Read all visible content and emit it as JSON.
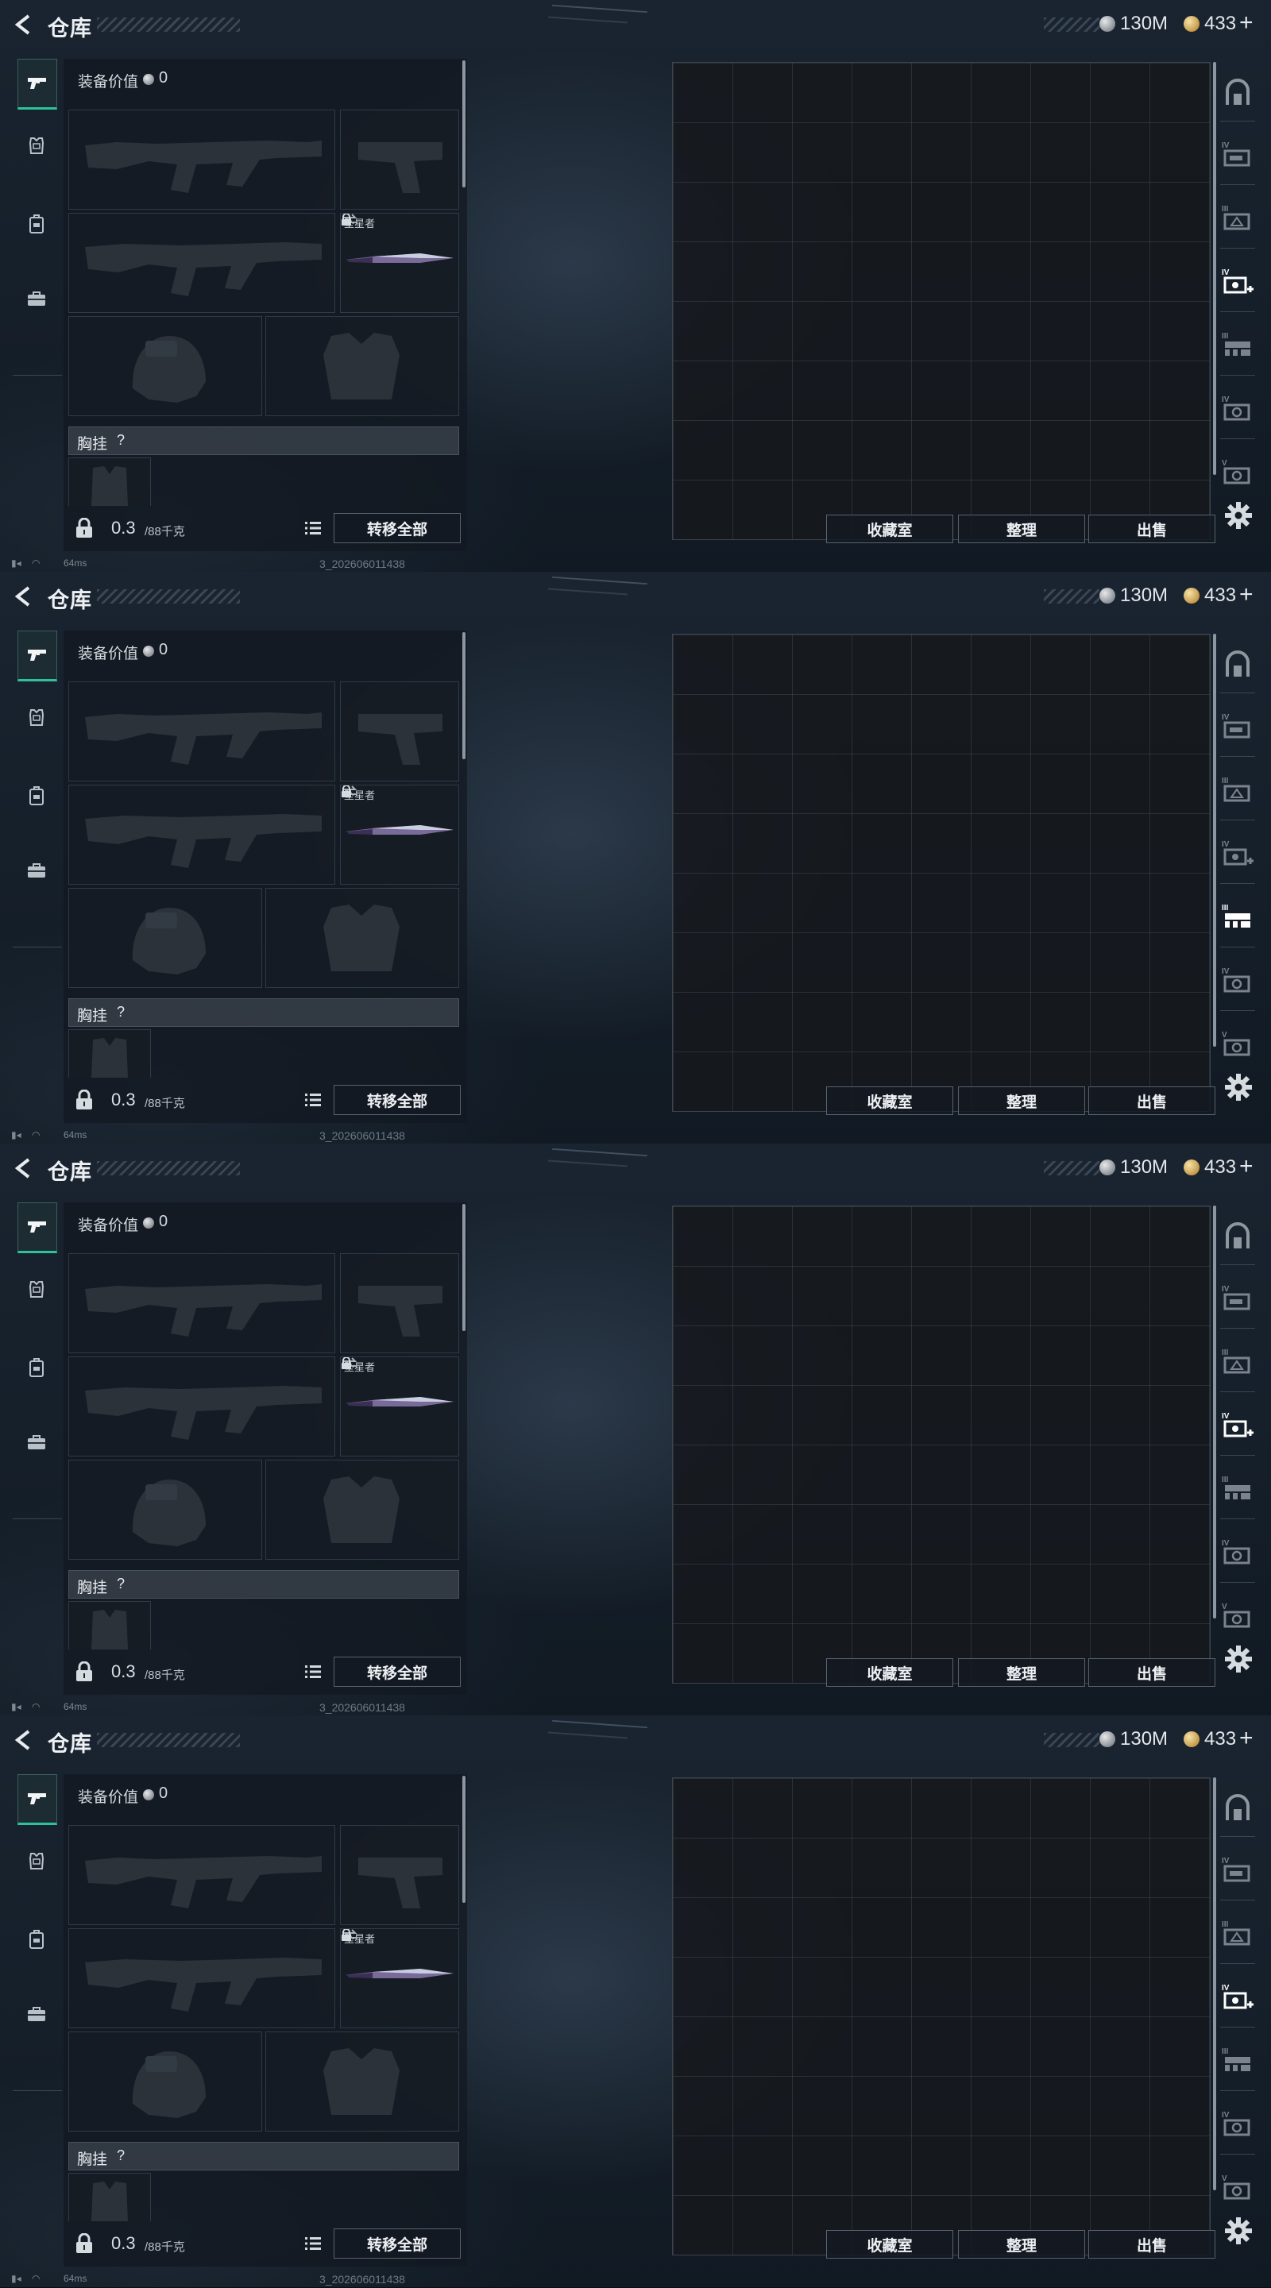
{
  "header": {
    "title": "仓库",
    "silver_value": "130M",
    "gold_value": "433",
    "plus_label": "+"
  },
  "equipment": {
    "value_label": "装备价值",
    "value": "0",
    "melee_name": "坠星者",
    "chest_rig_label": "胸挂",
    "chest_rig_hint": "?"
  },
  "capacity": {
    "current": "0.3",
    "max": "/88千克"
  },
  "buttons": {
    "transfer_all": "转移全部",
    "collection": "收藏室",
    "organize": "整理",
    "sell": "出售"
  },
  "status_bar": {
    "ping": "64ms",
    "build": "3_202606011438"
  },
  "frames": [
    {
      "active_side_tab": "IV-case-plus"
    },
    {
      "active_side_tab": "III-ammo-box"
    },
    {
      "active_side_tab": "IV-case-plus"
    },
    {
      "active_side_tab": "IV-case-plus"
    }
  ],
  "colors": {
    "accent": "#2cc39a",
    "panel": "#12181f",
    "button_border": "#56626e"
  }
}
